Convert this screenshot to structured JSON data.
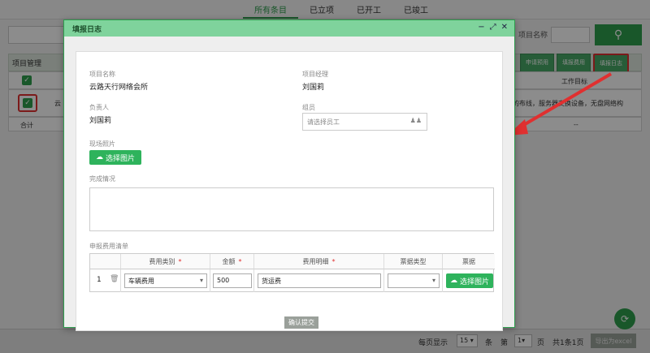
{
  "tabs": [
    {
      "label": "所有条目"
    },
    {
      "label": "已立项"
    },
    {
      "label": "已开工"
    },
    {
      "label": "已竣工"
    }
  ],
  "search": {
    "label": "项目名称",
    "button_icon": "search-icon"
  },
  "grid": {
    "title": "项目管理",
    "column_work_target": "工作目标",
    "row_prefix": "云",
    "row_desc": "的布线，服务器交换设备，无盘网络构",
    "total_label": "合计",
    "total_value": "--"
  },
  "toolbar_buttons": [
    "申请预用",
    "填报费用",
    "填报日志"
  ],
  "dialog": {
    "title": "填报日志",
    "controls": [
      "−",
      "⤢",
      "✕"
    ],
    "project_name_label": "项目名称",
    "project_name": "云路天行网络会所",
    "manager_label": "项目经理",
    "manager": "刘国莉",
    "owner_label": "负责人",
    "owner": "刘国莉",
    "member_label": "组员",
    "member_placeholder": "请选择员工",
    "photo_label": "现场照片",
    "photo_button": "选择图片",
    "completion_label": "完成情况",
    "expense_section_label": "申报费用清单",
    "table_headers": [
      "费用类别",
      "金额",
      "费用明细",
      "票据类型",
      "票据"
    ],
    "row": {
      "index": "1",
      "category": "车辆费用",
      "amount": "500",
      "detail": "货运费",
      "invoice_type": "",
      "invoice_button": "选择图片"
    },
    "submit": "确认提交"
  },
  "footer": {
    "per_page_label": "每页显示",
    "per_page": "15",
    "unit": "条",
    "page_prefix": "第",
    "page": "1",
    "page_suffix": "页",
    "total": "共1条1页",
    "export": "导出为excel"
  },
  "colors": {
    "accent": "#2e9e4e",
    "dialog_header": "#7fd39c",
    "highlight": "#e03030"
  }
}
